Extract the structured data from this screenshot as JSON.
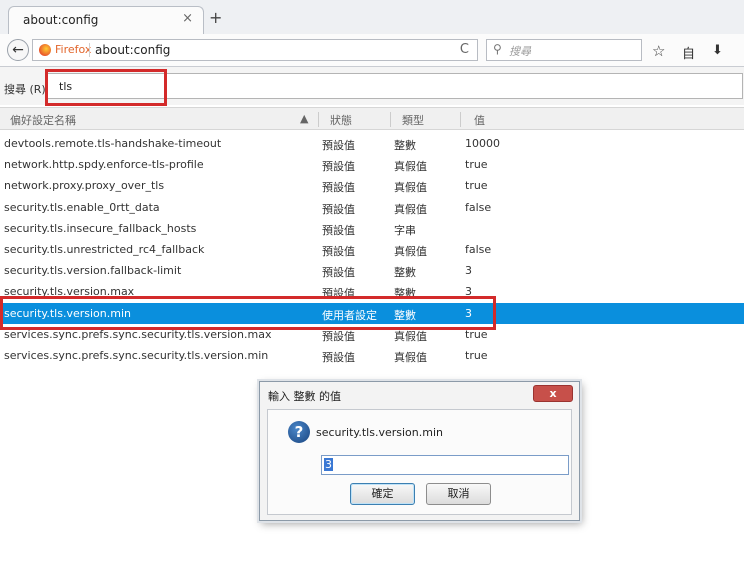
{
  "tab": {
    "title": "about:config",
    "close": "×",
    "new_tab": "+"
  },
  "navbar": {
    "back": "←",
    "identity": "Firefox",
    "url": "about:config",
    "reload": "C",
    "search_placeholder": "搜尋",
    "search_icon": "⚲",
    "bookmark_icon": "☆",
    "reading_list_icon": "自",
    "download_icon": "⬇"
  },
  "filter": {
    "label": "搜尋 (R):",
    "value": "tls"
  },
  "columns": {
    "name": "偏好設定名稱",
    "status": "狀態",
    "type": "類型",
    "value": "值"
  },
  "prefs": [
    {
      "name": "devtools.remote.tls-handshake-timeout",
      "status": "預設值",
      "type": "整數",
      "value": "10000"
    },
    {
      "name": "network.http.spdy.enforce-tls-profile",
      "status": "預設值",
      "type": "真假值",
      "value": "true"
    },
    {
      "name": "network.proxy.proxy_over_tls",
      "status": "預設值",
      "type": "真假值",
      "value": "true"
    },
    {
      "name": "security.tls.enable_0rtt_data",
      "status": "預設值",
      "type": "真假值",
      "value": "false"
    },
    {
      "name": "security.tls.insecure_fallback_hosts",
      "status": "預設值",
      "type": "字串",
      "value": ""
    },
    {
      "name": "security.tls.unrestricted_rc4_fallback",
      "status": "預設值",
      "type": "真假值",
      "value": "false"
    },
    {
      "name": "security.tls.version.fallback-limit",
      "status": "預設值",
      "type": "整數",
      "value": "3"
    },
    {
      "name": "security.tls.version.max",
      "status": "預設值",
      "type": "整數",
      "value": "3"
    },
    {
      "name": "security.tls.version.min",
      "status": "使用者設定",
      "type": "整數",
      "value": "3",
      "selected": true
    },
    {
      "name": "services.sync.prefs.sync.security.tls.version.max",
      "status": "預設值",
      "type": "真假值",
      "value": "true"
    },
    {
      "name": "services.sync.prefs.sync.security.tls.version.min",
      "status": "預設值",
      "type": "真假值",
      "value": "true"
    }
  ],
  "dialog": {
    "title": "輸入 整數 的值",
    "close": "x",
    "message": "security.tls.version.min",
    "input_value": "3",
    "ok": "確定",
    "cancel": "取消"
  },
  "colors": {
    "selection": "#0a8fdd",
    "highlight_box": "#d32a2a"
  }
}
